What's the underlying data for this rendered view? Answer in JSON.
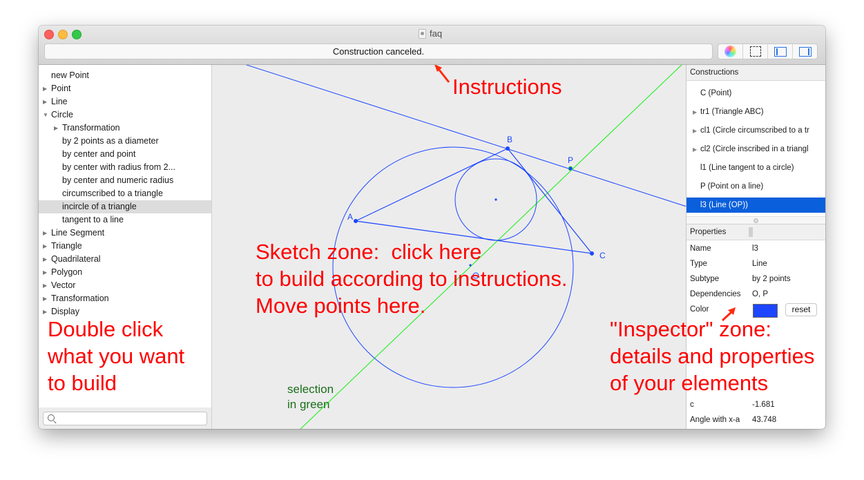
{
  "window": {
    "title": "faq",
    "status": "Construction canceled.",
    "toolbar": [
      {
        "name": "color-wheel-icon"
      },
      {
        "name": "selection-rect-icon"
      },
      {
        "name": "toggle-left-panel-icon"
      },
      {
        "name": "toggle-right-panel-icon"
      }
    ]
  },
  "sidebar": {
    "items": [
      {
        "label": "new Point",
        "level": 0,
        "disclosure": "none"
      },
      {
        "label": "Point",
        "level": 0,
        "disclosure": "collapsed"
      },
      {
        "label": "Line",
        "level": 0,
        "disclosure": "collapsed"
      },
      {
        "label": "Circle",
        "level": 0,
        "disclosure": "expanded"
      },
      {
        "label": "Transformation",
        "level": 1,
        "disclosure": "collapsed"
      },
      {
        "label": "by 2 points as a diameter",
        "level": 1,
        "disclosure": "none"
      },
      {
        "label": "by center and point",
        "level": 1,
        "disclosure": "none"
      },
      {
        "label": "by center with radius from 2...",
        "level": 1,
        "disclosure": "none"
      },
      {
        "label": "by center and numeric radius",
        "level": 1,
        "disclosure": "none"
      },
      {
        "label": "circumscribed to a triangle",
        "level": 1,
        "disclosure": "none"
      },
      {
        "label": "incircle of a triangle",
        "level": 1,
        "disclosure": "none",
        "selected": true
      },
      {
        "label": "tangent to a line",
        "level": 1,
        "disclosure": "none"
      },
      {
        "label": "Line Segment",
        "level": 0,
        "disclosure": "collapsed"
      },
      {
        "label": "Triangle",
        "level": 0,
        "disclosure": "collapsed"
      },
      {
        "label": "Quadrilateral",
        "level": 0,
        "disclosure": "collapsed"
      },
      {
        "label": "Polygon",
        "level": 0,
        "disclosure": "collapsed"
      },
      {
        "label": "Vector",
        "level": 0,
        "disclosure": "collapsed"
      },
      {
        "label": "Transformation",
        "level": 0,
        "disclosure": "collapsed"
      },
      {
        "label": "Display",
        "level": 0,
        "disclosure": "collapsed"
      }
    ],
    "search_placeholder": ""
  },
  "sketch": {
    "points": [
      {
        "label": "A"
      },
      {
        "label": "B"
      },
      {
        "label": "C"
      },
      {
        "label": "P"
      },
      {
        "label": "O"
      }
    ],
    "colors": {
      "construction": "#1c46ff",
      "selection": "#22ee22"
    }
  },
  "inspector": {
    "constructions_header": "Constructions",
    "constructions": [
      {
        "label": "C (Point)",
        "expandable": false
      },
      {
        "label": "tr1 (Triangle ABC)",
        "expandable": true
      },
      {
        "label": "cl1 (Circle circumscribed to a tr",
        "expandable": true
      },
      {
        "label": "cl2 (Circle inscribed in a triangl",
        "expandable": true
      },
      {
        "label": "l1 (Line tangent to a circle)",
        "expandable": false
      },
      {
        "label": "P (Point on a line)",
        "expandable": false
      },
      {
        "label": "l3 (Line (OP))",
        "expandable": false,
        "selected": true
      }
    ],
    "properties_header": "Properties",
    "properties": [
      {
        "key": "Name",
        "value": "l3"
      },
      {
        "key": "Type",
        "value": "Line"
      },
      {
        "key": "Subtype",
        "value": "by 2 points"
      },
      {
        "key": "Dependencies",
        "value": "O, P"
      }
    ],
    "color_label": "Color",
    "color_value": "#1c46ff",
    "reset_label": "reset",
    "extra_properties": [
      {
        "key": "c",
        "value": "-1.681"
      },
      {
        "key": "Angle with x-a",
        "value": "43.748"
      }
    ]
  },
  "annotations": {
    "instructions": "Instructions",
    "sketch_zone": "Sketch zone:  click here\nto build according to instructions.\nMove points here.",
    "double_click": "Double click\nwhat you want\nto build",
    "inspector_zone": "\"Inspector\" zone:\ndetails and properties\nof your elements",
    "selection": "selection\nin green",
    "arrow_color": "#ff2a10"
  }
}
